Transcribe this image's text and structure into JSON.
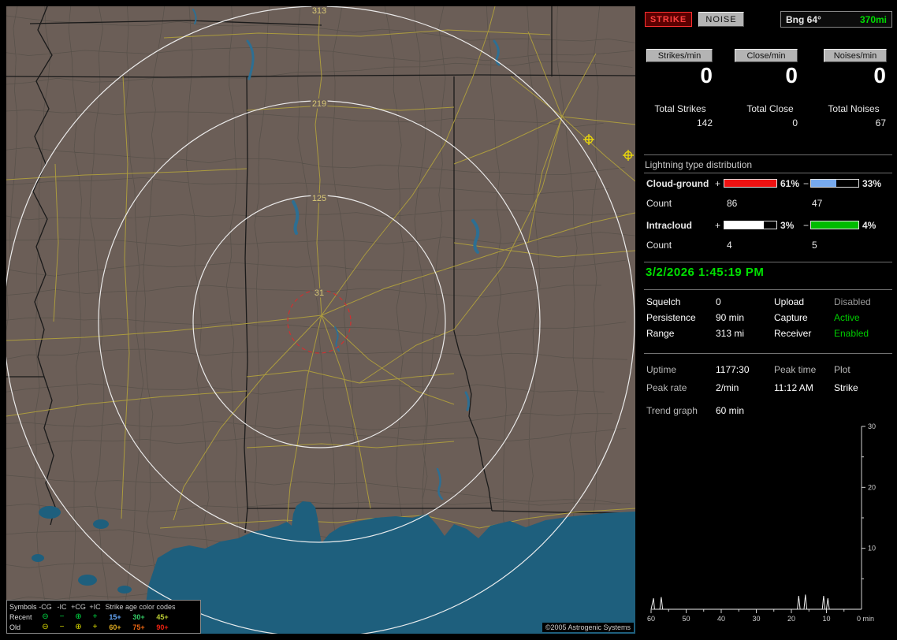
{
  "header": {
    "strike_button": "STRIKE",
    "noise_button": "NOISE",
    "bearing": "Bng 64°",
    "distance": "370mi"
  },
  "counters": {
    "columns": [
      {
        "button": "Strikes/min",
        "rate": "0",
        "total_label": "Total Strikes",
        "total_value": "142"
      },
      {
        "button": "Close/min",
        "rate": "0",
        "total_label": "Total Close",
        "total_value": "0"
      },
      {
        "button": "Noises/min",
        "rate": "0",
        "total_label": "Total Noises",
        "total_value": "67"
      }
    ]
  },
  "distribution": {
    "title": "Lightning type distribution",
    "rows": [
      {
        "label": "Cloud-ground",
        "plus_sign": "+",
        "plus_pct": "61%",
        "plus_fill": 1,
        "plus_color": "#ee1111",
        "minus_sign": "−",
        "minus_pct": "33%",
        "minus_fill": 0.54,
        "minus_color": "#77aaee",
        "count_label": "Count",
        "plus_count": "86",
        "minus_count": "47"
      },
      {
        "label": "Intracloud",
        "plus_sign": "+",
        "plus_pct": "3%",
        "plus_fill": 0.75,
        "plus_color": "#ffffff",
        "minus_sign": "−",
        "minus_pct": "4%",
        "minus_fill": 1,
        "minus_color": "#00bb00",
        "count_label": "Count",
        "plus_count": "4",
        "minus_count": "5"
      }
    ]
  },
  "status": {
    "datetime": "3/2/2026 1:45:19 PM",
    "rows": [
      {
        "l1": "Squelch",
        "v1": "0",
        "l2": "Upload",
        "v2": "Disabled",
        "v2_color": "#9a9a9a"
      },
      {
        "l1": "Persistence",
        "v1": "90 min",
        "l2": "Capture",
        "v2": "Active",
        "v2_color": "#00cc00"
      },
      {
        "l1": "Range",
        "v1": "313 mi",
        "l2": "Receiver",
        "v2": "Enabled",
        "v2_color": "#00cc00"
      }
    ]
  },
  "stats": {
    "rows": [
      [
        "Uptime",
        "1177:30",
        "Peak time",
        "Plot"
      ],
      [
        "Peak rate",
        "2/min",
        "11:12 AM",
        "Strike"
      ]
    ],
    "trend_label": "Trend graph",
    "trend_window": "60 min"
  },
  "chart_data": {
    "type": "line",
    "title": "Trend graph",
    "window": "60 min",
    "series_name": "Strike",
    "xlim": [
      60,
      0
    ],
    "ylim": [
      0,
      30
    ],
    "x_ticks": [
      60,
      50,
      40,
      30,
      20,
      10
    ],
    "x_end_label": "0 min",
    "y_ticks": [
      10,
      20,
      30
    ],
    "points": [
      [
        60,
        0
      ],
      [
        59.3,
        1.8
      ],
      [
        59,
        0
      ],
      [
        57.5,
        0
      ],
      [
        57.1,
        2
      ],
      [
        56.7,
        0
      ],
      [
        18.3,
        0
      ],
      [
        17.9,
        2.2
      ],
      [
        17.5,
        0
      ],
      [
        16.4,
        0
      ],
      [
        16,
        2.4
      ],
      [
        15.6,
        0
      ],
      [
        11.2,
        0
      ],
      [
        10.8,
        2.2
      ],
      [
        10.4,
        0
      ],
      [
        10,
        0
      ],
      [
        9.6,
        1.8
      ],
      [
        9.2,
        0
      ],
      [
        0,
        0
      ]
    ]
  },
  "map": {
    "range_ring_labels": [
      "313",
      "219",
      "125",
      "31"
    ],
    "copyright": "©2005 Astrogenic Systems",
    "legend": {
      "symbols_header": "Symbols",
      "symbol_columns": [
        "-CG",
        "-IC",
        "+CG",
        "+IC"
      ],
      "age_header": "Strike age color codes",
      "rows": [
        {
          "label": "Recent",
          "color": "#00dd44",
          "symbols": [
            "⊖",
            "−",
            "⊕",
            "+"
          ],
          "ages": [
            {
              "t": "15+",
              "c": "#66aaff"
            },
            {
              "t": "30+",
              "c": "#33cc66"
            },
            {
              "t": "45+",
              "c": "#bbcc33"
            }
          ]
        },
        {
          "label": "Old",
          "color": "#dddd00",
          "symbols": [
            "⊖",
            "−",
            "⊕",
            "+"
          ],
          "ages": [
            {
              "t": "60+",
              "c": "#ddaa22"
            },
            {
              "t": "75+",
              "c": "#ee6611"
            },
            {
              "t": "90+",
              "c": "#ee2211"
            }
          ]
        }
      ]
    }
  }
}
